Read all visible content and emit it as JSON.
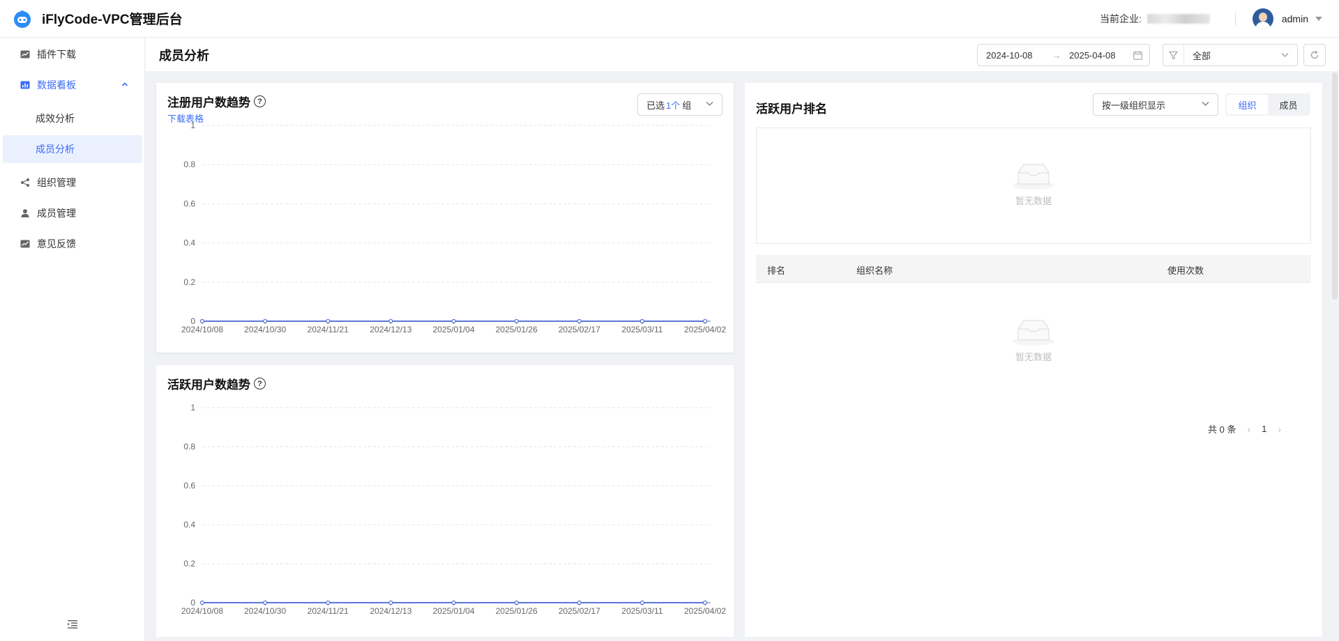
{
  "header": {
    "app_title": "iFlyCode-VPC管理后台",
    "company_label": "当前企业:",
    "username": "admin"
  },
  "sidebar": {
    "items": [
      {
        "label": "插件下载",
        "icon": "chart-line-icon"
      },
      {
        "label": "数据看板",
        "icon": "bar-chart-icon",
        "expanded": true
      },
      {
        "label": "成效分析"
      },
      {
        "label": "成员分析",
        "active": true
      },
      {
        "label": "组织管理",
        "icon": "org-tree-icon"
      },
      {
        "label": "成员管理",
        "icon": "user-icon"
      },
      {
        "label": "意见反馈",
        "icon": "feedback-chart-icon"
      }
    ]
  },
  "page": {
    "title": "成员分析",
    "date_start": "2024-10-08",
    "date_arrow": "→",
    "date_end": "2025-04-08",
    "filter_value": "全部"
  },
  "registered_card": {
    "title": "注册用户数趋势",
    "help": "?",
    "download_label": "下载表格",
    "group_select": {
      "prefix": "已选",
      "count": "1个",
      "suffix": "组"
    }
  },
  "active_card": {
    "title": "活跃用户数趋势",
    "help": "?"
  },
  "ranking": {
    "title": "活跃用户排名",
    "org_select": "按一级组织显示",
    "segments": [
      "组织",
      "成员"
    ],
    "active_segment": "组织",
    "empty_text": "暂无数据",
    "columns": [
      "排名",
      "组织名称",
      "使用次数"
    ],
    "table_empty_text": "暂无数据",
    "total_label": "共 0 条",
    "page_number": "1"
  },
  "colors": {
    "accent": "#3b6cf6",
    "line": "#5b76d6"
  },
  "chart_data": [
    {
      "type": "line",
      "title": "注册用户数趋势",
      "x": [
        "2024/10/08",
        "2024/10/30",
        "2024/11/21",
        "2024/12/13",
        "2025/01/04",
        "2025/01/26",
        "2025/02/17",
        "2025/03/11",
        "2025/04/02"
      ],
      "series": [
        {
          "values": [
            0,
            0,
            0,
            0,
            0,
            0,
            0,
            0,
            0
          ]
        }
      ],
      "yticks": [
        "0",
        "0.2",
        "0.4",
        "0.6",
        "0.8",
        "1"
      ],
      "ylim": [
        0,
        1
      ],
      "grid": true
    },
    {
      "type": "line",
      "title": "活跃用户数趋势",
      "x": [
        "2024/10/08",
        "2024/10/30",
        "2024/11/21",
        "2024/12/13",
        "2025/01/04",
        "2025/01/26",
        "2025/02/17",
        "2025/03/11",
        "2025/04/02"
      ],
      "series": [
        {
          "values": [
            0,
            0,
            0,
            0,
            0,
            0,
            0,
            0,
            0
          ]
        }
      ],
      "yticks": [
        "0",
        "0.2",
        "0.4",
        "0.6",
        "0.8",
        "1"
      ],
      "ylim": [
        0,
        1
      ],
      "grid": true
    }
  ]
}
